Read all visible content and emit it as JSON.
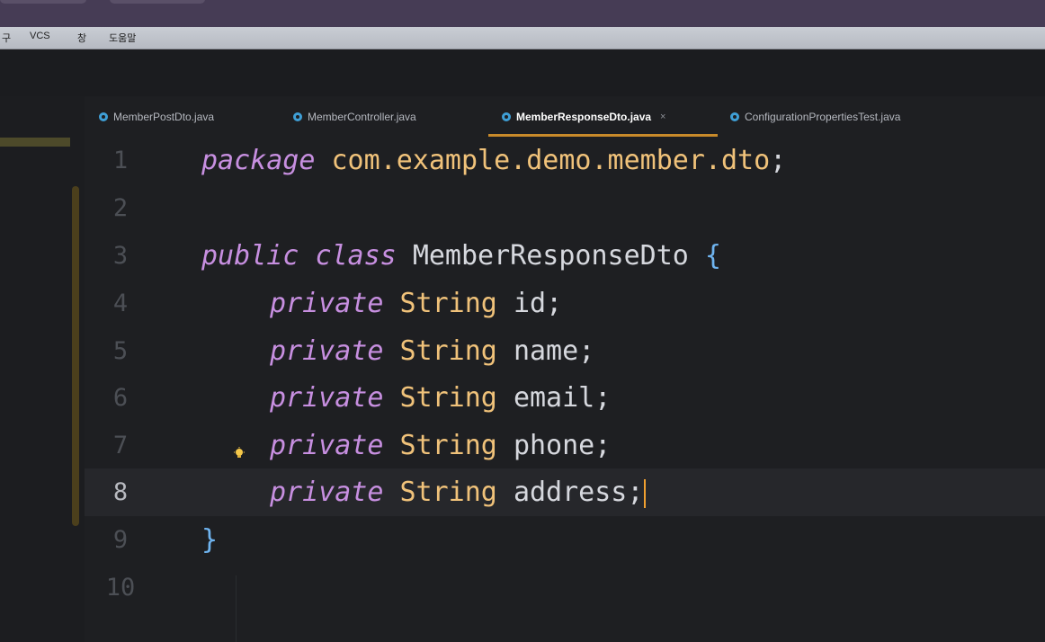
{
  "menu": {
    "items": [
      "구",
      "VCS",
      "창",
      "도움말"
    ]
  },
  "tabs": [
    {
      "label": "MemberPostDto.java",
      "active": false
    },
    {
      "label": "MemberController.java",
      "active": false
    },
    {
      "label": "MemberResponseDto.java",
      "active": true,
      "close": "×"
    },
    {
      "label": "ConfigurationPropertiesTest.java",
      "active": false
    }
  ],
  "editor": {
    "line_numbers": [
      "1",
      "2",
      "3",
      "4",
      "5",
      "6",
      "7",
      "8",
      "9",
      "10"
    ],
    "current_line": "8",
    "code": {
      "l1": {
        "kw": "package",
        "pkg": "com.example.demo.member.dto",
        "end": ";"
      },
      "l3": {
        "kw1": "public",
        "kw2": "class",
        "name": "MemberResponseDto",
        "brace": "{"
      },
      "fields": [
        {
          "kw": "private",
          "type": "String",
          "name": "id",
          "end": ";"
        },
        {
          "kw": "private",
          "type": "String",
          "name": "name",
          "end": ";"
        },
        {
          "kw": "private",
          "type": "String",
          "name": "email",
          "end": ";"
        },
        {
          "kw": "private",
          "type": "String",
          "name": "phone",
          "end": ";"
        },
        {
          "kw": "private",
          "type": "String",
          "name": "address",
          "end": ";"
        }
      ],
      "l9": {
        "brace": "}"
      }
    }
  },
  "colors": {
    "keyword": "#c78fe0",
    "type": "#f0c27a",
    "brace": "#6fb4f0",
    "tab_accent": "#c88a2a",
    "caret": "#f0a030"
  },
  "icons": {
    "tab_icon": "java-class-icon",
    "intention": "lightbulb-icon"
  }
}
